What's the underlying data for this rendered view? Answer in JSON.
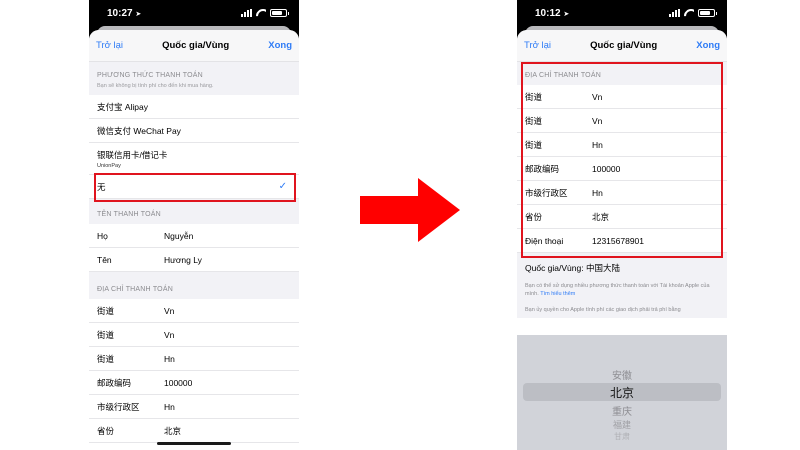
{
  "left_phone": {
    "status": {
      "time": "10:27",
      "location_icon": "location-arrow-icon"
    },
    "nav": {
      "back": "Trở lại",
      "title": "Quốc gia/Vùng",
      "done": "Xong"
    },
    "payment_section": {
      "header": "PHƯƠNG THỨC THANH TOÁN",
      "subtext": "Bạn sẽ không bị tính phí cho đến khi mua hàng.",
      "options": [
        {
          "label": "支付宝 Alipay"
        },
        {
          "label": "微信支付 WeChat Pay"
        },
        {
          "label": "银联信用卡/借记卡",
          "sub": "UnionPay"
        },
        {
          "label": "无",
          "selected": true
        }
      ]
    },
    "name_section": {
      "header": "TÊN THANH TOÁN",
      "rows": [
        {
          "key": "Họ",
          "value": "Nguyễn"
        },
        {
          "key": "Tên",
          "value": "Hương Ly"
        }
      ]
    },
    "address_section": {
      "header": "ĐỊA CHỈ THANH TOÁN",
      "rows": [
        {
          "key": "街道",
          "value": "Vn"
        },
        {
          "key": "街道",
          "value": "Vn"
        },
        {
          "key": "街道",
          "value": "Hn"
        },
        {
          "key": "邮政编码",
          "value": "100000"
        },
        {
          "key": "市级行政区",
          "value": "Hn"
        },
        {
          "key": "省份",
          "value": "北京"
        }
      ]
    }
  },
  "right_phone": {
    "status": {
      "time": "10:12",
      "location_icon": "location-arrow-icon"
    },
    "nav": {
      "back": "Trở lại",
      "title": "Quốc gia/Vùng",
      "done": "Xong"
    },
    "address_section": {
      "header": "ĐỊA CHỈ THANH TOÁN",
      "rows": [
        {
          "key": "街道",
          "value": "Vn"
        },
        {
          "key": "街道",
          "value": "Vn"
        },
        {
          "key": "街道",
          "value": "Hn"
        },
        {
          "key": "邮政编码",
          "value": "100000"
        },
        {
          "key": "市级行政区",
          "value": "Hn"
        },
        {
          "key": "省份",
          "value": "北京"
        },
        {
          "key": "Điện thoại",
          "value": "12315678901"
        }
      ]
    },
    "country": "Quốc gia/Vùng: 中国大陆",
    "info1": "Bạn có thể sử dụng nhiều phương thức thanh toán với Tài khoản Apple của mình.",
    "info1_link": "Tìm hiểu thêm",
    "info2": "Bạn ủy quyền cho Apple tính phí các giao dịch phải trả phí bằng",
    "picker": {
      "items": [
        "安徽",
        "北京",
        "重庆",
        "福建",
        "甘肃"
      ],
      "selected": "北京"
    }
  },
  "colors": {
    "accent": "#2f7cf6",
    "highlight": "#e0141e",
    "arrow": "#ff0000"
  }
}
